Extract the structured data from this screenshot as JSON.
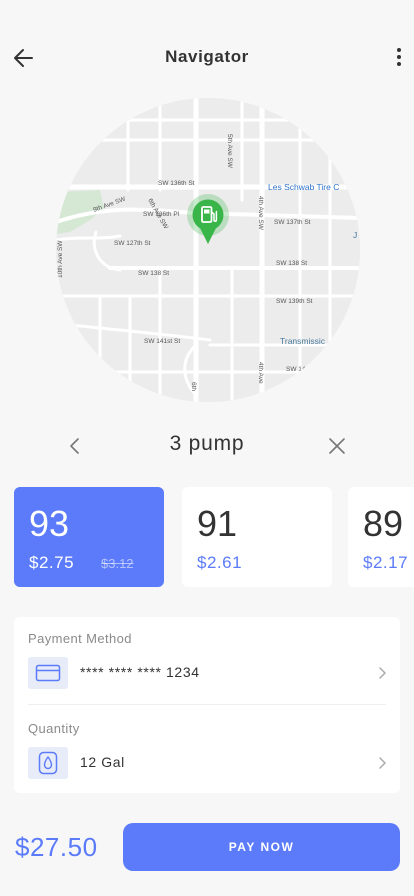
{
  "header": {
    "title": "Navigator",
    "back_icon": "arrow-left-icon",
    "menu_icon": "more-vertical-icon"
  },
  "map": {
    "pin_icon": "fuel-station-icon",
    "pin_color": "#3ab54a",
    "labels": {
      "sw136": "SW 136th St",
      "les_schwab": "Les Schwab Tire C",
      "sw136pl": "SW 136th Pl",
      "sw137": "SW 137th St",
      "sw127": "SW 127th St",
      "sw138a": "SW 138 St",
      "sw138b": "SW 138 St",
      "sw139": "SW 139th St",
      "sw141": "SW 141st St",
      "sw142": "SW 142nd",
      "transmission": "Transmissic",
      "ave4a": "4th Ave SW",
      "ave4b": "4th Ave",
      "ave5": "5th Ave SW",
      "ave6": "6th Ave SW",
      "ave9": "9th Ave SW",
      "ave10": "10th Ave SW",
      "j": "J",
      "ave6b": "6th"
    }
  },
  "pump": {
    "label": "3 pump",
    "prev_icon": "chevron-left-icon",
    "close_icon": "close-icon"
  },
  "fuel_options": [
    {
      "grade": "93",
      "price": "$2.75",
      "old_price": "$3.12",
      "selected": true
    },
    {
      "grade": "91",
      "price": "$2.61",
      "selected": false
    },
    {
      "grade": "89",
      "price": "$2.17",
      "selected": false
    }
  ],
  "payment": {
    "method_label": "Payment Method",
    "card_number": "**** **** **** 1234",
    "card_icon": "credit-card-icon",
    "quantity_label": "Quantity",
    "quantity_value": "12 Gal",
    "quantity_icon": "fuel-drop-icon"
  },
  "footer": {
    "total": "$27.50",
    "pay_label": "PAY NOW"
  },
  "colors": {
    "accent": "#5b7bfa",
    "background": "#f7f7f8",
    "icon_bg": "#e8ecf9"
  }
}
